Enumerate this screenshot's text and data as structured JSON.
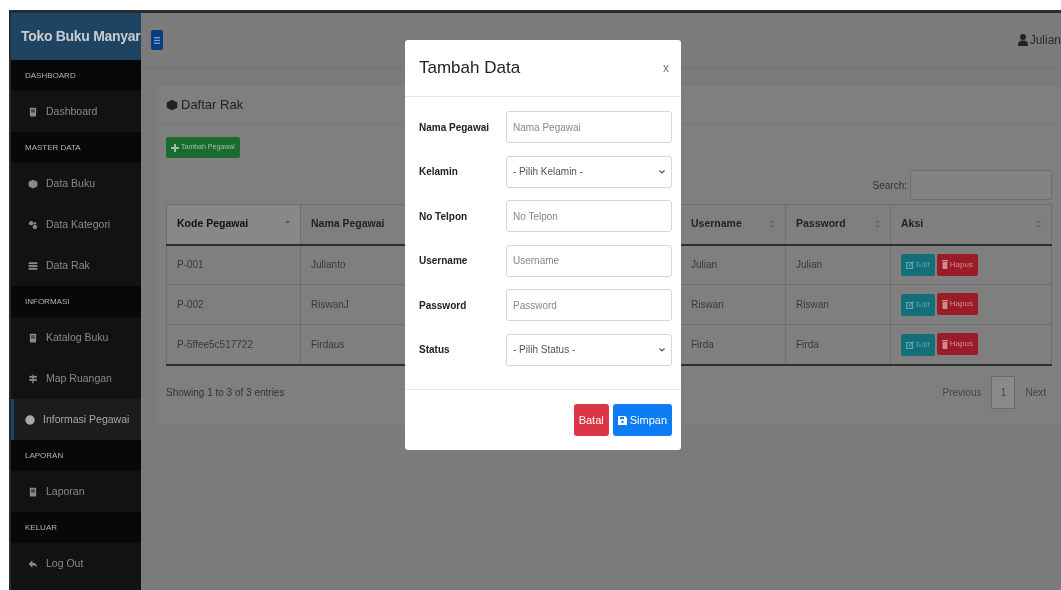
{
  "brand": "Toko Buku Manyar",
  "sidebar": [
    {
      "kind": "heading",
      "label": "DASHBOARD"
    },
    {
      "kind": "item",
      "label": "Dashboard",
      "selected": false
    },
    {
      "kind": "heading",
      "label": "MASTER DATA"
    },
    {
      "kind": "item",
      "label": "Data Buku",
      "selected": false
    },
    {
      "kind": "item",
      "label": "Data Kategori",
      "selected": false
    },
    {
      "kind": "item",
      "label": "Data Rak",
      "selected": false
    },
    {
      "kind": "heading",
      "label": "INFORMASI"
    },
    {
      "kind": "item",
      "label": "Katalog Buku",
      "selected": false
    },
    {
      "kind": "item",
      "label": "Map Ruangan",
      "selected": false
    },
    {
      "kind": "item",
      "label": "Informasi Pegawai",
      "selected": true
    },
    {
      "kind": "heading",
      "label": "LAPORAN"
    },
    {
      "kind": "item",
      "label": "Laporan",
      "selected": false
    },
    {
      "kind": "heading",
      "label": "KELUAR"
    },
    {
      "kind": "item",
      "label": "Log Out",
      "selected": false
    }
  ],
  "topbar": {
    "user": "Julian"
  },
  "card": {
    "title": "Daftar Rak",
    "add_button": "Tambah Pegawai",
    "search_label": "Search:",
    "table": {
      "columns": [
        {
          "label": "Kode Pegawai",
          "sorted": true
        },
        {
          "label": "Nama Pegawai",
          "sorted": false
        },
        {
          "label": "Username",
          "sorted": false
        },
        {
          "label": "Password",
          "sorted": false
        },
        {
          "label": "Aksi",
          "sorted": false
        }
      ],
      "rows": [
        {
          "cells": [
            "P-001",
            "Julianto",
            "Julian",
            "Julian"
          ],
          "actions": [
            "Edit",
            "Hapus"
          ]
        },
        {
          "cells": [
            "P-002",
            "RiswanJ",
            "Riswan",
            "Riswan"
          ],
          "actions": [
            "Edit",
            "Hapus"
          ]
        },
        {
          "cells": [
            "P-5ffee5c517722",
            "Firdaus",
            "Firda",
            "Firda"
          ],
          "actions": [
            "Edit",
            "Hapus"
          ]
        }
      ]
    },
    "info": "Showing 1 to 3 of 3 entries",
    "pagination": {
      "previous": "Previous",
      "pages": [
        {
          "label": "1",
          "selected": true
        }
      ],
      "next": "Next"
    }
  },
  "modal": {
    "title": "Tambah Data",
    "close": "x",
    "fields": [
      {
        "kind": "input",
        "label": "Nama Pegawai",
        "placeholder": "Nama Pegawai"
      },
      {
        "kind": "select",
        "label": "Kelamin",
        "value": "- Pilih Kelamin -"
      },
      {
        "kind": "input",
        "label": "No Telpon",
        "placeholder": "No Telpon"
      },
      {
        "kind": "input",
        "label": "Username",
        "placeholder": "Username"
      },
      {
        "kind": "input",
        "label": "Password",
        "placeholder": "Password"
      },
      {
        "kind": "select",
        "label": "Status",
        "value": "- Pilih Status -"
      }
    ],
    "buttons": [
      {
        "kind": "danger",
        "label": "Batal"
      },
      {
        "kind": "primary",
        "label": "Simpan"
      }
    ]
  }
}
